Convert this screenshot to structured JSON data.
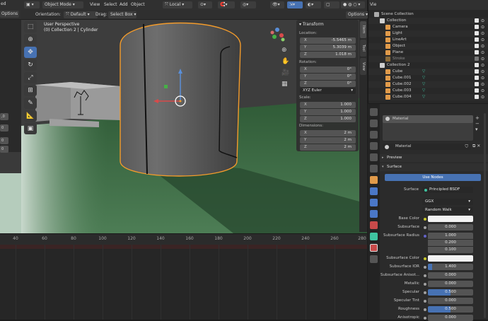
{
  "top_menu": {
    "frag_left": "ed",
    "frag_right": "Vie"
  },
  "left_panel": {
    "options_label": "Options",
    "fields": [
      ",0",
      "0",
      "0",
      "0"
    ]
  },
  "viewport_header": {
    "orientation_label": "Orientation:",
    "orientation_value": "Default",
    "drag_label": "Drag:",
    "drag_value": "Select Box",
    "mode": "Object Mode",
    "menus": [
      "View",
      "Select",
      "Add",
      "Object"
    ],
    "transform_orientation": "Local",
    "options_label": "Options"
  },
  "viewport": {
    "perspective_text": "User Perspective",
    "collection_text": "(0) Collection 2 | Cylinder"
  },
  "npanel": {
    "title": "Transform",
    "location_label": "Location:",
    "location": [
      {
        "axis": "X",
        "value": "-5.5465 m"
      },
      {
        "axis": "Y",
        "value": "5.3039 m"
      },
      {
        "axis": "Z",
        "value": "1.018 m"
      }
    ],
    "rotation_label": "Rotation:",
    "rotation": [
      {
        "axis": "X",
        "value": "0°"
      },
      {
        "axis": "Y",
        "value": "0°"
      },
      {
        "axis": "Z",
        "value": "0°"
      }
    ],
    "rotation_mode": "XYZ Euler",
    "scale_label": "Scale:",
    "scale": [
      {
        "axis": "X",
        "value": "1.000"
      },
      {
        "axis": "Y",
        "value": "1.000"
      },
      {
        "axis": "Z",
        "value": "1.000"
      }
    ],
    "dimensions_label": "Dimensions:",
    "dimensions": [
      {
        "axis": "X",
        "value": "2 m"
      },
      {
        "axis": "Y",
        "value": "2 m"
      },
      {
        "axis": "Z",
        "value": "2 m"
      }
    ],
    "side_tabs": [
      "Item",
      "Tool",
      "View"
    ]
  },
  "timeline": {
    "ticks": [
      "40",
      "60",
      "80",
      "100",
      "120",
      "140",
      "160",
      "180",
      "200",
      "220",
      "240",
      "260",
      "280"
    ]
  },
  "outliner": {
    "title": "Scene Collection",
    "rows": [
      {
        "label": "Collection",
        "indent": 1
      },
      {
        "label": "Camera",
        "indent": 2
      },
      {
        "label": "Light",
        "indent": 2
      },
      {
        "label": "LineArt",
        "indent": 2
      },
      {
        "label": "Object",
        "indent": 2
      },
      {
        "label": "Plane",
        "indent": 2
      },
      {
        "label": "Stroke",
        "indent": 2
      },
      {
        "label": "Collection 2",
        "indent": 1
      },
      {
        "label": "Cube",
        "indent": 2
      },
      {
        "label": "Cube.001",
        "indent": 2
      },
      {
        "label": "Cube.002",
        "indent": 2
      },
      {
        "label": "Cube.003",
        "indent": 2
      },
      {
        "label": "Cube.004",
        "indent": 2
      }
    ]
  },
  "properties": {
    "slot_name": "Material",
    "material_name": "Material",
    "preview_label": "Preview",
    "surface_section": "Surface",
    "use_nodes_label": "Use Nodes",
    "surface_label": "Surface",
    "surface_value": "Principled BSDF",
    "distribution": "GGX",
    "subsurface_method": "Random Walk",
    "params": [
      {
        "label": "Base Color",
        "value": ""
      },
      {
        "label": "Subsurface",
        "value": "0.000"
      },
      {
        "label": "Subsurface Radius",
        "value": "1.000"
      },
      {
        "label": "",
        "value": "0.200"
      },
      {
        "label": "",
        "value": "0.100"
      },
      {
        "label": "Subsurface Color",
        "value": ""
      },
      {
        "label": "Subsurface IOR",
        "value": "1.400"
      },
      {
        "label": "Subsurface Anisot...",
        "value": "0.000"
      },
      {
        "label": "Metallic",
        "value": "0.000"
      },
      {
        "label": "Specular",
        "value": "0.500"
      },
      {
        "label": "Specular Tint",
        "value": "0.000"
      },
      {
        "label": "Roughness",
        "value": "0.500"
      },
      {
        "label": "Anisotropic",
        "value": "0.000"
      }
    ]
  },
  "colors": {
    "accent": "#4772b3",
    "selection_outline": "#f39b2b",
    "ground": "#3a6a44",
    "sky": "#3d3d3d"
  }
}
